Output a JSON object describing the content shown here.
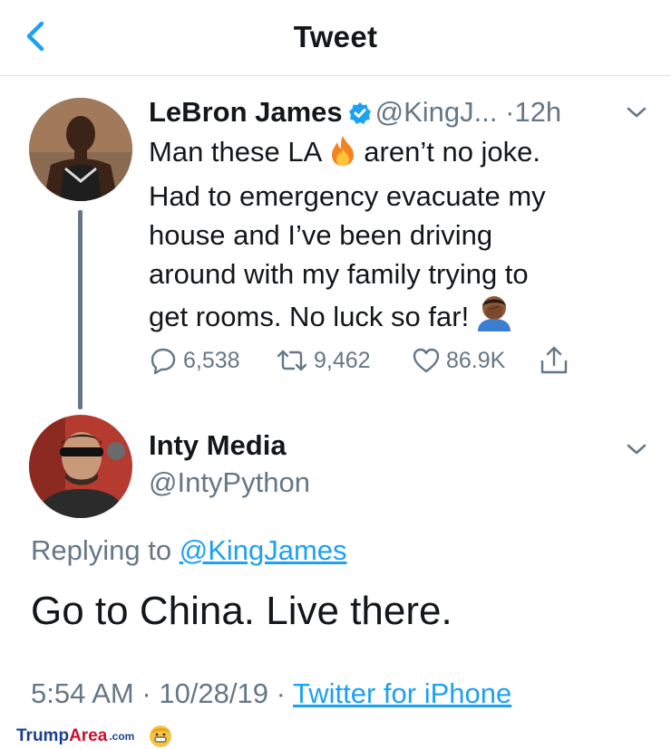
{
  "header": {
    "title": "Tweet",
    "back_icon": "chevron-left-icon"
  },
  "tweet": {
    "author_name": "LeBron James",
    "verified_icon": "verified-badge-icon",
    "handle": "@KingJ...",
    "separator": "·",
    "time": "12h",
    "body": {
      "line1_a": "Man these LA",
      "line1_emoji": "fire-emoji",
      "line1_b": "aren’t no joke.",
      "line2": "Had to emergency evacuate my",
      "line3": "house and I’ve been driving",
      "line4": "around with my family trying to",
      "line5": "get rooms. No luck so far!",
      "line5_emoji": "facepalm-emoji"
    },
    "actions": {
      "replies": "6,538",
      "retweets": "9,462",
      "likes": "86.9K"
    }
  },
  "reply": {
    "author_name": "Inty Media",
    "handle": "@IntyPython",
    "replying_prefix": "Replying to",
    "replying_to": "@KingJames",
    "text": "Go to China. Live there.",
    "time": "5:54 AM",
    "date": "10/28/19",
    "separator": "·",
    "source": "Twitter for iPhone"
  },
  "watermark": {
    "part1": "Trump",
    "part2": "Area",
    "part3": ".com"
  },
  "colors": {
    "link": "#1da1f2",
    "muted": "#657786",
    "text": "#14171a",
    "verified": "#1da1f2"
  }
}
